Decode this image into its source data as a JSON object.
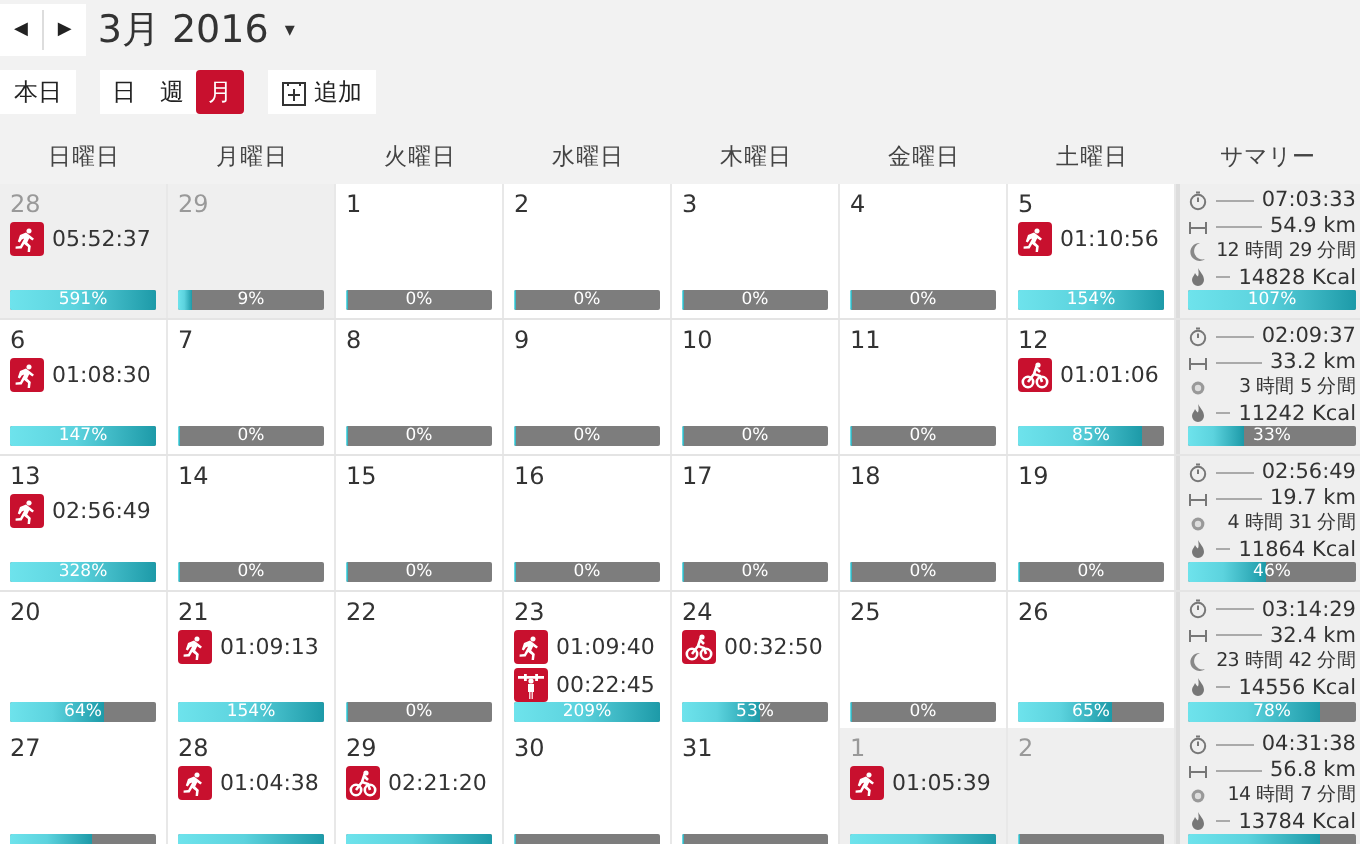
{
  "toolbar": {
    "prev": "◀",
    "next": "▶",
    "title": "3月 2016",
    "title_caret": "▾",
    "today": "本日",
    "views": [
      {
        "label": "日",
        "selected": false
      },
      {
        "label": "週",
        "selected": false
      },
      {
        "label": "月",
        "selected": true
      }
    ],
    "add": "追加"
  },
  "weekdays": [
    "日曜日",
    "月曜日",
    "火曜日",
    "水曜日",
    "木曜日",
    "金曜日",
    "土曜日",
    "サマリー"
  ],
  "weeks": [
    {
      "days": [
        {
          "date": "28",
          "other_month": true,
          "activities": [
            {
              "kind": "run",
              "duration": "05:52:37"
            }
          ],
          "progress": {
            "level": 1,
            "label": "591%"
          }
        },
        {
          "date": "29",
          "other_month": true,
          "progress": {
            "level": 0.09,
            "label": "9%"
          }
        },
        {
          "date": "1",
          "other_month": false,
          "progress": {
            "level": 0,
            "label": "0%"
          }
        },
        {
          "date": "2",
          "other_month": false,
          "progress": {
            "level": 0,
            "label": "0%"
          }
        },
        {
          "date": "3",
          "other_month": false,
          "progress": {
            "level": 0,
            "label": "0%"
          }
        },
        {
          "date": "4",
          "other_month": false,
          "progress": {
            "level": 0,
            "label": "0%"
          }
        },
        {
          "date": "5",
          "other_month": false,
          "activities": [
            {
              "kind": "run",
              "duration": "01:10:56"
            }
          ],
          "progress": {
            "level": 1,
            "label": "154%"
          }
        }
      ],
      "summary": {
        "time": "07:03:33",
        "distance": "54.9 km",
        "sleep_moon": true,
        "sleep": "12 時間 29 分間",
        "calories": "14828 Kcal",
        "progress": {
          "level": 1,
          "label": "107%"
        }
      }
    },
    {
      "days": [
        {
          "date": "6",
          "other_month": false,
          "activities": [
            {
              "kind": "run",
              "duration": "01:08:30"
            }
          ],
          "progress": {
            "level": 1,
            "label": "147%"
          }
        },
        {
          "date": "7",
          "other_month": false,
          "progress": {
            "level": 0,
            "label": "0%"
          }
        },
        {
          "date": "8",
          "other_month": false,
          "progress": {
            "level": 0,
            "label": "0%"
          }
        },
        {
          "date": "9",
          "other_month": false,
          "progress": {
            "level": 0,
            "label": "0%"
          }
        },
        {
          "date": "10",
          "other_month": false,
          "progress": {
            "level": 0,
            "label": "0%"
          }
        },
        {
          "date": "11",
          "other_month": false,
          "progress": {
            "level": 0,
            "label": "0%"
          }
        },
        {
          "date": "12",
          "other_month": false,
          "activities": [
            {
              "kind": "bike",
              "duration": "01:01:06"
            }
          ],
          "progress": {
            "level": 0.85,
            "label": "85%"
          }
        }
      ],
      "summary": {
        "time": "02:09:37",
        "distance": "33.2 km",
        "sleep_moon": false,
        "sleep": "3 時間 5 分間",
        "calories": "11242 Kcal",
        "progress": {
          "level": 0.33,
          "label": "33%"
        }
      }
    },
    {
      "days": [
        {
          "date": "13",
          "other_month": false,
          "activities": [
            {
              "kind": "run",
              "duration": "02:56:49"
            }
          ],
          "progress": {
            "level": 1,
            "label": "328%"
          }
        },
        {
          "date": "14",
          "other_month": false,
          "progress": {
            "level": 0,
            "label": "0%"
          }
        },
        {
          "date": "15",
          "other_month": false,
          "progress": {
            "level": 0,
            "label": "0%"
          }
        },
        {
          "date": "16",
          "other_month": false,
          "progress": {
            "level": 0,
            "label": "0%"
          }
        },
        {
          "date": "17",
          "other_month": false,
          "progress": {
            "level": 0,
            "label": "0%"
          }
        },
        {
          "date": "18",
          "other_month": false,
          "progress": {
            "level": 0,
            "label": "0%"
          }
        },
        {
          "date": "19",
          "other_month": false,
          "progress": {
            "level": 0,
            "label": "0%"
          }
        }
      ],
      "summary": {
        "time": "02:56:49",
        "distance": "19.7 km",
        "sleep_moon": false,
        "sleep": "4 時間 31 分間",
        "calories": "11864 Kcal",
        "progress": {
          "level": 0.46,
          "label": "46%"
        }
      }
    },
    {
      "days": [
        {
          "date": "20",
          "other_month": false,
          "progress": {
            "level": 0.64,
            "label": "64%"
          }
        },
        {
          "date": "21",
          "other_month": false,
          "activities": [
            {
              "kind": "run",
              "duration": "01:09:13"
            }
          ],
          "progress": {
            "level": 1,
            "label": "154%"
          }
        },
        {
          "date": "22",
          "other_month": false,
          "progress": {
            "level": 0,
            "label": "0%"
          }
        },
        {
          "date": "23",
          "other_month": false,
          "activities": [
            {
              "kind": "run",
              "duration": "01:09:40"
            },
            {
              "kind": "strength",
              "duration": "00:22:45"
            }
          ],
          "progress": {
            "level": 1,
            "label": "209%"
          }
        },
        {
          "date": "24",
          "other_month": false,
          "activities": [
            {
              "kind": "bike",
              "duration": "00:32:50"
            }
          ],
          "progress": {
            "level": 0.53,
            "label": "53%"
          }
        },
        {
          "date": "25",
          "other_month": false,
          "progress": {
            "level": 0,
            "label": "0%"
          }
        },
        {
          "date": "26",
          "other_month": false,
          "progress": {
            "level": 0.65,
            "label": "65%"
          }
        }
      ],
      "summary": {
        "time": "03:14:29",
        "distance": "32.4 km",
        "sleep_moon": true,
        "sleep": "23 時間 42 分間",
        "calories": "14556 Kcal",
        "progress": {
          "level": 0.78,
          "label": "78%"
        }
      }
    },
    {
      "days": [
        {
          "date": "27",
          "other_month": false,
          "progress": {
            "level": 0.56
          }
        },
        {
          "date": "28",
          "other_month": false,
          "activities": [
            {
              "kind": "run",
              "duration": "01:04:38"
            }
          ],
          "progress": {
            "level": 1
          }
        },
        {
          "date": "29",
          "other_month": false,
          "activities": [
            {
              "kind": "bike",
              "duration": "02:21:20"
            }
          ],
          "progress": {
            "level": 1
          }
        },
        {
          "date": "30",
          "other_month": false,
          "progress": {
            "level": 0
          }
        },
        {
          "date": "31",
          "other_month": false,
          "progress": {
            "level": 0
          }
        },
        {
          "date": "1",
          "other_month": true,
          "activities": [
            {
              "kind": "run",
              "duration": "01:05:39"
            }
          ],
          "progress": {
            "level": 1
          }
        },
        {
          "date": "2",
          "other_month": true,
          "progress": {
            "level": 0
          }
        }
      ],
      "summary": {
        "time": "04:31:38",
        "distance": "56.8 km",
        "sleep_moon": false,
        "sleep": "14 時間 7 分間",
        "calories": "13784 Kcal",
        "progress": {
          "level": 0.79
        }
      }
    }
  ]
}
